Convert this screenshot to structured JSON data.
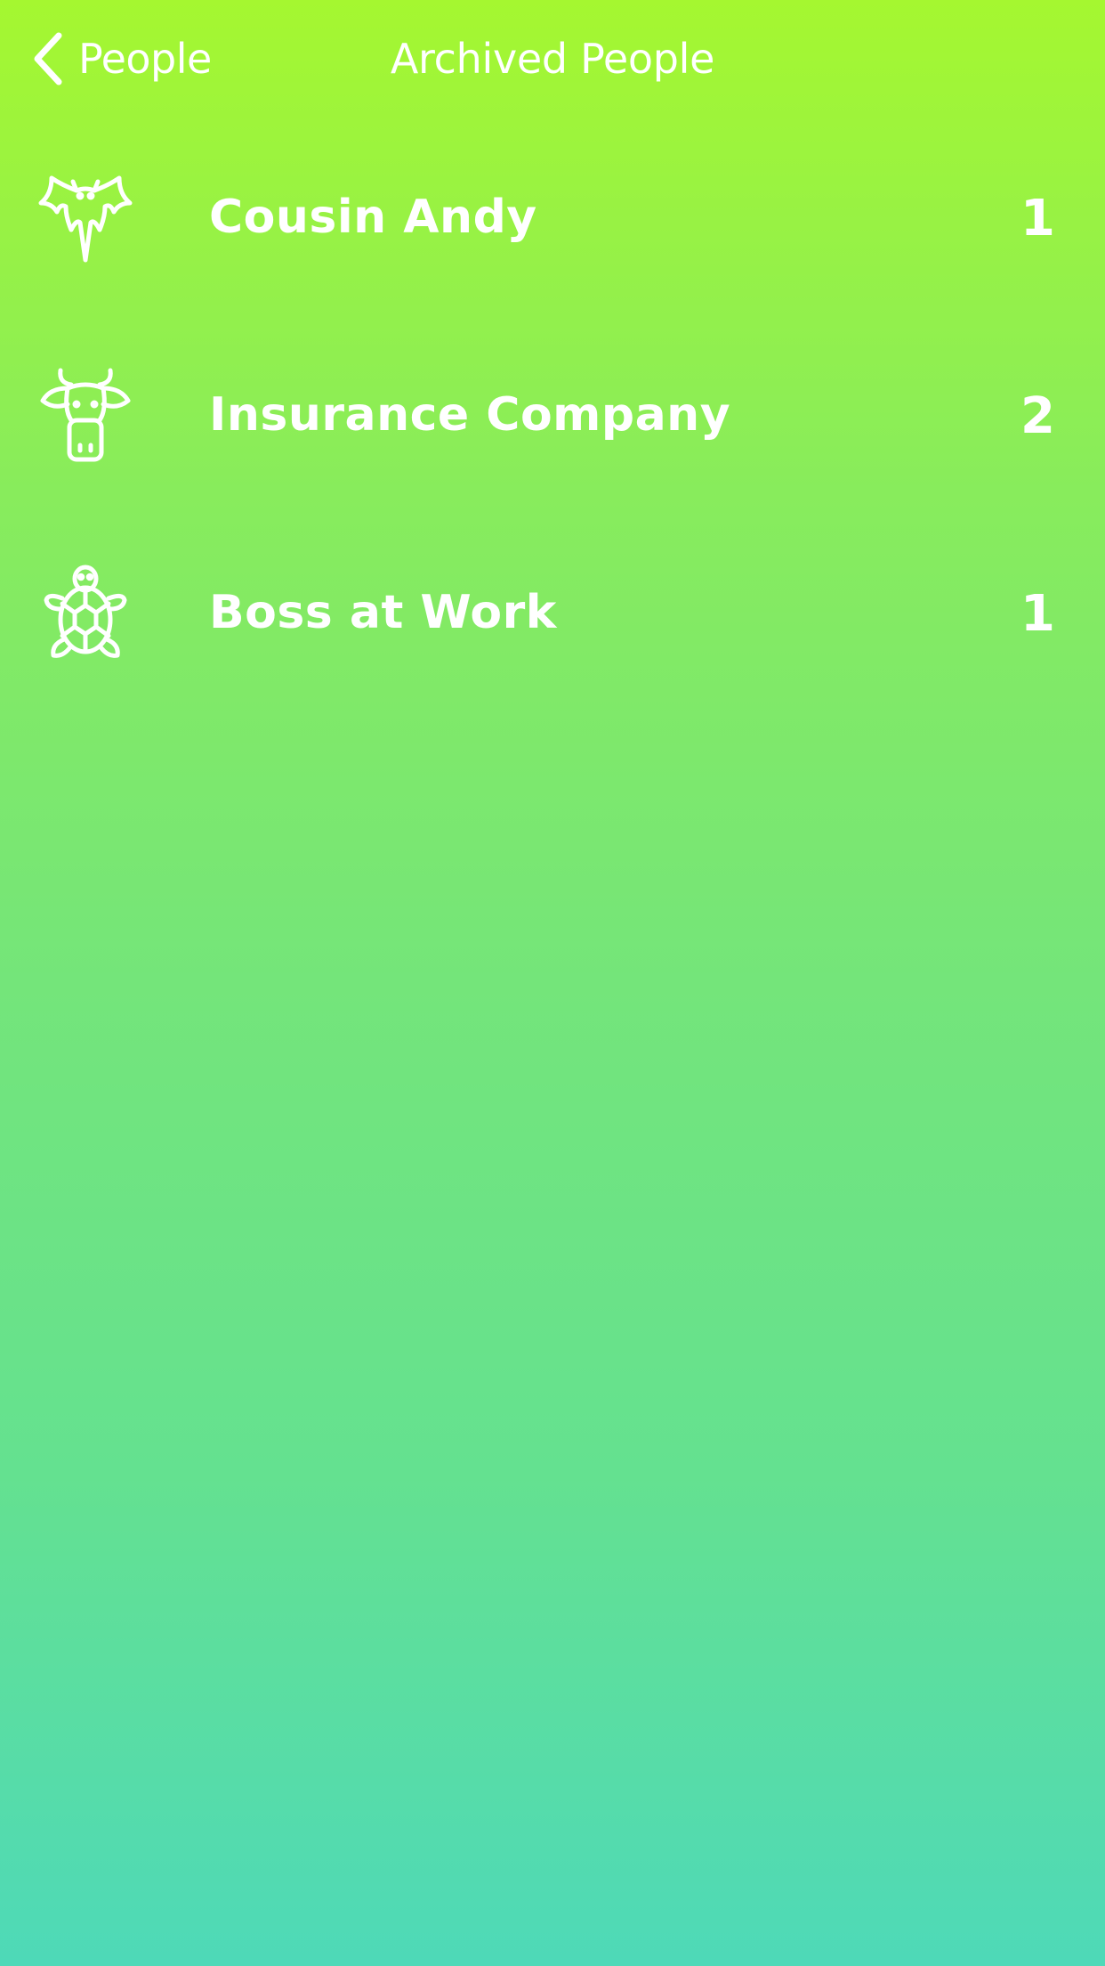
{
  "navbar": {
    "back_label": "People",
    "title": "Archived People",
    "back_icon": "chevron-left-icon"
  },
  "colors": {
    "gradient_top": "#a5f730",
    "gradient_bottom": "#4ed9b8",
    "text": "#ffffff"
  },
  "people": [
    {
      "name": "Cousin Andy",
      "count": "1",
      "icon": "bat-icon"
    },
    {
      "name": "Insurance Company",
      "count": "2",
      "icon": "cow-icon"
    },
    {
      "name": "Boss at Work",
      "count": "1",
      "icon": "turtle-icon"
    }
  ]
}
